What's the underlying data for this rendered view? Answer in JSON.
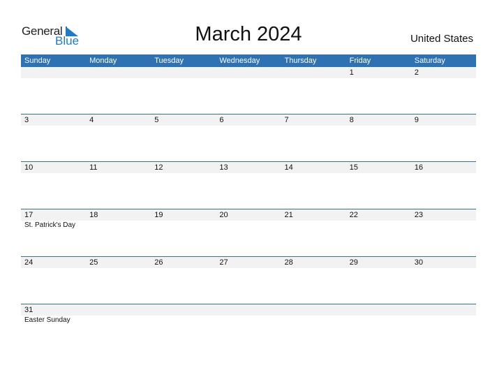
{
  "logo": {
    "general": "General",
    "blue": "Blue"
  },
  "title": "March 2024",
  "country": "United States",
  "colors": {
    "header_bg": "#2e72b4",
    "date_row_bg": "#f2f2f2",
    "logo_blue": "#1f7bc8"
  },
  "weekdays": [
    "Sunday",
    "Monday",
    "Tuesday",
    "Wednesday",
    "Thursday",
    "Friday",
    "Saturday"
  ],
  "weeks": [
    {
      "days": [
        "",
        "",
        "",
        "",
        "",
        "1",
        "2"
      ],
      "holidays": [
        "",
        "",
        "",
        "",
        "",
        "",
        ""
      ]
    },
    {
      "days": [
        "3",
        "4",
        "5",
        "6",
        "7",
        "8",
        "9"
      ],
      "holidays": [
        "",
        "",
        "",
        "",
        "",
        "",
        ""
      ]
    },
    {
      "days": [
        "10",
        "11",
        "12",
        "13",
        "14",
        "15",
        "16"
      ],
      "holidays": [
        "",
        "",
        "",
        "",
        "",
        "",
        ""
      ]
    },
    {
      "days": [
        "17",
        "18",
        "19",
        "20",
        "21",
        "22",
        "23"
      ],
      "holidays": [
        "St. Patrick's Day",
        "",
        "",
        "",
        "",
        "",
        ""
      ]
    },
    {
      "days": [
        "24",
        "25",
        "26",
        "27",
        "28",
        "29",
        "30"
      ],
      "holidays": [
        "",
        "",
        "",
        "",
        "",
        "",
        ""
      ]
    },
    {
      "days": [
        "31",
        "",
        "",
        "",
        "",
        "",
        ""
      ],
      "holidays": [
        "Easter Sunday",
        "",
        "",
        "",
        "",
        "",
        ""
      ]
    }
  ]
}
